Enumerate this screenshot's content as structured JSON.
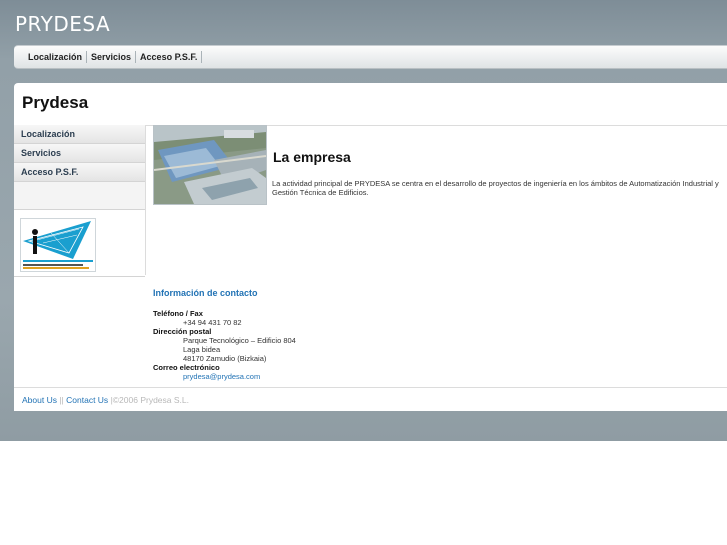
{
  "site": {
    "title": "PRYDESA"
  },
  "topnav": {
    "items": [
      {
        "label": "Localización"
      },
      {
        "label": "Servicios"
      },
      {
        "label": "Acceso P.S.F."
      }
    ]
  },
  "panel": {
    "heading": "Prydesa"
  },
  "sidebar": {
    "items": [
      {
        "label": "Localización"
      },
      {
        "label": "Servicios"
      },
      {
        "label": "Acceso P.S.F."
      }
    ]
  },
  "content": {
    "heading": "La empresa",
    "intro": "La actividad principal de PRYDESA se centra en el desarrollo de proyectos de ingeniería en los ámbitos de  Automatización Industrial y Gestión Técnica de Edificios."
  },
  "contact": {
    "title": "Información de contacto",
    "phone_label": "Teléfono / Fax",
    "phone": "+34  94 431 70 82",
    "address_label": "Dirección postal",
    "address_lines": [
      "Parque Tecnológico – Edificio 804",
      "Laga bidea",
      "48170 Zamudio (Bizkaia)"
    ],
    "email_label": "Correo electrónico",
    "email": "prydesa@prydesa.com"
  },
  "footer": {
    "about": "About Us",
    "divider": "||",
    "contact": "Contact Us",
    "pipe": "|",
    "copyright": "©2006 Prydesa S.L."
  }
}
